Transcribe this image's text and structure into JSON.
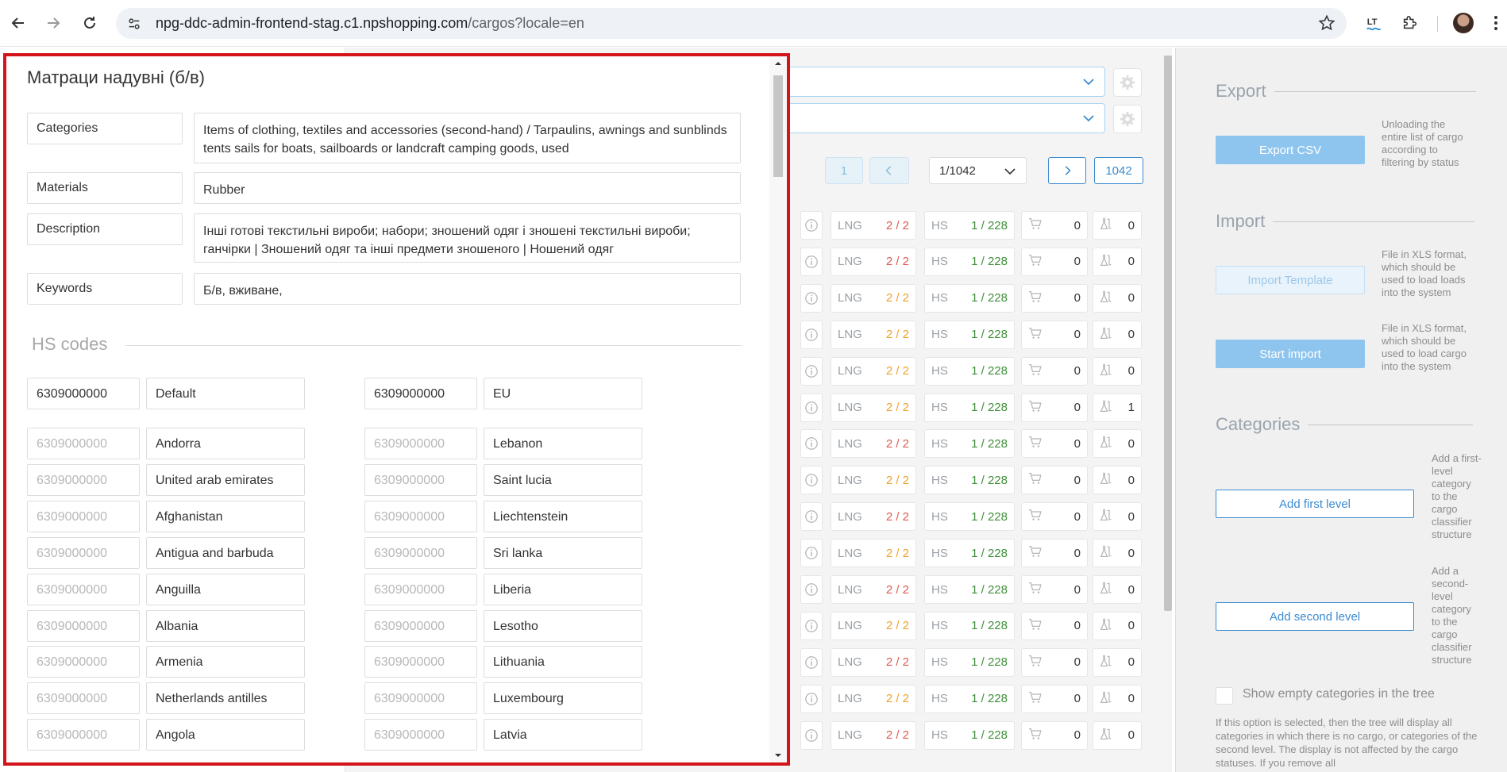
{
  "browser": {
    "url_host": "npg-ddc-admin-frontend-stag.c1.npshopping.com",
    "url_path": "/cargos?locale=en"
  },
  "pagination": {
    "first": "1",
    "current": "1/1042",
    "last": "1042"
  },
  "rows": [
    {
      "lng_label": "LNG",
      "lng": "2 / 2",
      "lng_color": "#e05a4f",
      "hs_label": "HS",
      "hs": "1 / 228",
      "cart": "0",
      "lab": "0"
    },
    {
      "lng_label": "LNG",
      "lng": "2 / 2",
      "lng_color": "#e05a4f",
      "hs_label": "HS",
      "hs": "1 / 228",
      "cart": "0",
      "lab": "0"
    },
    {
      "lng_label": "LNG",
      "lng": "2 / 2",
      "lng_color": "#f0a12b",
      "hs_label": "HS",
      "hs": "1 / 228",
      "cart": "0",
      "lab": "0"
    },
    {
      "lng_label": "LNG",
      "lng": "2 / 2",
      "lng_color": "#f0a12b",
      "hs_label": "HS",
      "hs": "1 / 228",
      "cart": "0",
      "lab": "0"
    },
    {
      "lng_label": "LNG",
      "lng": "2 / 2",
      "lng_color": "#f0a12b",
      "hs_label": "HS",
      "hs": "1 / 228",
      "cart": "0",
      "lab": "0"
    },
    {
      "lng_label": "LNG",
      "lng": "2 / 2",
      "lng_color": "#f0a12b",
      "hs_label": "HS",
      "hs": "1 / 228",
      "cart": "0",
      "lab": "1"
    },
    {
      "lng_label": "LNG",
      "lng": "2 / 2",
      "lng_color": "#e05a4f",
      "hs_label": "HS",
      "hs": "1 / 228",
      "cart": "0",
      "lab": "0"
    },
    {
      "lng_label": "LNG",
      "lng": "2 / 2",
      "lng_color": "#f0a12b",
      "hs_label": "HS",
      "hs": "1 / 228",
      "cart": "0",
      "lab": "0"
    },
    {
      "lng_label": "LNG",
      "lng": "2 / 2",
      "lng_color": "#e05a4f",
      "hs_label": "HS",
      "hs": "1 / 228",
      "cart": "0",
      "lab": "0"
    },
    {
      "lng_label": "LNG",
      "lng": "2 / 2",
      "lng_color": "#f0a12b",
      "hs_label": "HS",
      "hs": "1 / 228",
      "cart": "0",
      "lab": "0"
    },
    {
      "lng_label": "LNG",
      "lng": "2 / 2",
      "lng_color": "#e05a4f",
      "hs_label": "HS",
      "hs": "1 / 228",
      "cart": "0",
      "lab": "0"
    },
    {
      "lng_label": "LNG",
      "lng": "2 / 2",
      "lng_color": "#f0a12b",
      "hs_label": "HS",
      "hs": "1 / 228",
      "cart": "0",
      "lab": "0"
    },
    {
      "lng_label": "LNG",
      "lng": "2 / 2",
      "lng_color": "#e05a4f",
      "hs_label": "HS",
      "hs": "1 / 228",
      "cart": "0",
      "lab": "0"
    },
    {
      "lng_label": "LNG",
      "lng": "2 / 2",
      "lng_color": "#f0a12b",
      "hs_label": "HS",
      "hs": "1 / 228",
      "cart": "0",
      "lab": "0"
    },
    {
      "lng_label": "LNG",
      "lng": "2 / 2",
      "lng_color": "#e05a4f",
      "hs_label": "HS",
      "hs": "1 / 228",
      "cart": "0",
      "lab": "0"
    }
  ],
  "side": {
    "export_title": "Export",
    "export_button": "Export CSV",
    "export_desc": "Unloading the entire list of cargo according to filtering by status",
    "import_title": "Import",
    "import_template_button": "Import Template",
    "import_template_desc": "File in XLS format, which should be used to load loads into the system",
    "start_import_button": "Start import",
    "start_import_desc": "File in XLS format, which should be used to load cargo into the system",
    "categories_title": "Categories",
    "add_first_button": "Add first level",
    "add_first_desc": "Add a first-level category to the cargo classifier structure",
    "add_second_button": "Add second level",
    "add_second_desc": "Add a second-level category to the cargo classifier structure",
    "show_empty_label": "Show empty categories in the tree",
    "note": "If this option is selected, then the tree will display all categories in which there is no cargo, or categories of the second level. The display is not affected by the cargo statuses. If you remove all"
  },
  "modal": {
    "title": "Матраци надувні (б/в)",
    "fields": [
      {
        "label": "Categories",
        "value": "Items of clothing, textiles and accessories (second-hand) / Tarpaulins, awnings and sunblinds tents sails for boats, sailboards or landcraft camping goods, used"
      },
      {
        "label": "Materials",
        "value": "Rubber"
      },
      {
        "label": "Description",
        "value": "Інші готові текстильні вироби; набори; зношений одяг і зношені текстильні вироби; ганчірки | Зношений одяг та інші предмети зношеного | Ношений одяг"
      },
      {
        "label": "Keywords",
        "value": "Б/в, вживане,"
      }
    ],
    "hs_title": "HS codes",
    "default_code": {
      "code": "6309000000",
      "country": "Default"
    },
    "eu_code": {
      "code": "6309000000",
      "country": "EU"
    },
    "left_codes": [
      {
        "code": "6309000000",
        "country": "Andorra"
      },
      {
        "code": "6309000000",
        "country": "United arab emirates"
      },
      {
        "code": "6309000000",
        "country": "Afghanistan"
      },
      {
        "code": "6309000000",
        "country": "Antigua and barbuda"
      },
      {
        "code": "6309000000",
        "country": "Anguilla"
      },
      {
        "code": "6309000000",
        "country": "Albania"
      },
      {
        "code": "6309000000",
        "country": "Armenia"
      },
      {
        "code": "6309000000",
        "country": "Netherlands antilles"
      },
      {
        "code": "6309000000",
        "country": "Angola"
      }
    ],
    "right_codes": [
      {
        "code": "6309000000",
        "country": "Lebanon"
      },
      {
        "code": "6309000000",
        "country": "Saint lucia"
      },
      {
        "code": "6309000000",
        "country": "Liechtenstein"
      },
      {
        "code": "6309000000",
        "country": "Sri lanka"
      },
      {
        "code": "6309000000",
        "country": "Liberia"
      },
      {
        "code": "6309000000",
        "country": "Lesotho"
      },
      {
        "code": "6309000000",
        "country": "Lithuania"
      },
      {
        "code": "6309000000",
        "country": "Luxembourg"
      },
      {
        "code": "6309000000",
        "country": "Latvia"
      }
    ]
  }
}
